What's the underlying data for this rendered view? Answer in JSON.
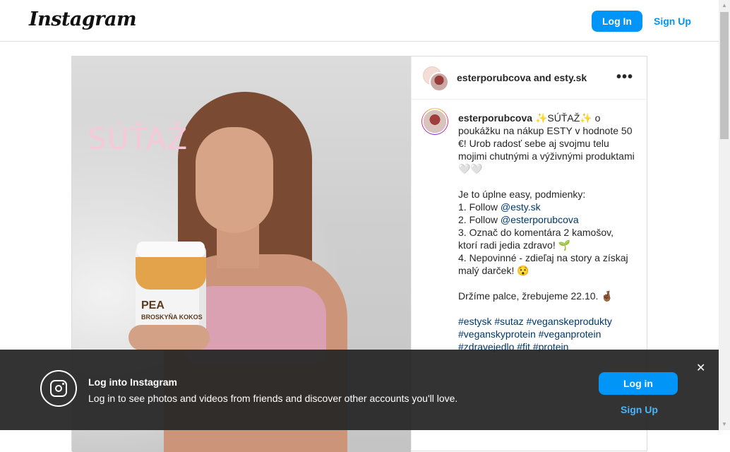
{
  "header": {
    "logo": "Instagram",
    "login_label": "Log In",
    "signup_label": "Sign Up"
  },
  "post": {
    "image_overlay_text": "SÚŤAŽ",
    "jar_label": "PEA",
    "jar_sublabel": "BROSKYŇA KOKOS",
    "header_names": "esterporubcova and esty.sk",
    "more_icon": "•••",
    "caption": {
      "username": "esterporubcova",
      "line1": "✨SÚŤAŽ✨ o poukážku na nákup ESTY v hodnote 50 €! Urob radosť sebe aj svojmu telu mojimi chutnými a výživnými produktami 🤍🤍",
      "conditions_intro": "Je to úplne easy, podmienky:",
      "c1_prefix": "1. Follow ",
      "c1_mention": "@esty.sk",
      "c2_prefix": "2. Follow ",
      "c2_mention": "@esterporubcova",
      "c3": "3. Označ do komentára 2 kamošov, ktorí radi jedia zdravo! 🌱",
      "c4": "4. Nepovinné - zdieľaj na story a získaj malý darček! 😯",
      "closing": "Držíme palce, žrebujeme 22.10. 🤞🏾",
      "hashtags": "#estysk #sutaz #veganskeprodukty #veganskyprotein #veganprotein #zdravejedlo #fit #protein"
    }
  },
  "banner": {
    "title": "Log into Instagram",
    "text": "Log in to see photos and videos from friends and discover other accounts you'll love.",
    "login_label": "Log in",
    "signup_label": "Sign Up",
    "close_icon": "✕"
  },
  "colors": {
    "accent": "#0095f6",
    "link": "#00376b",
    "banner_bg": "#262626"
  }
}
